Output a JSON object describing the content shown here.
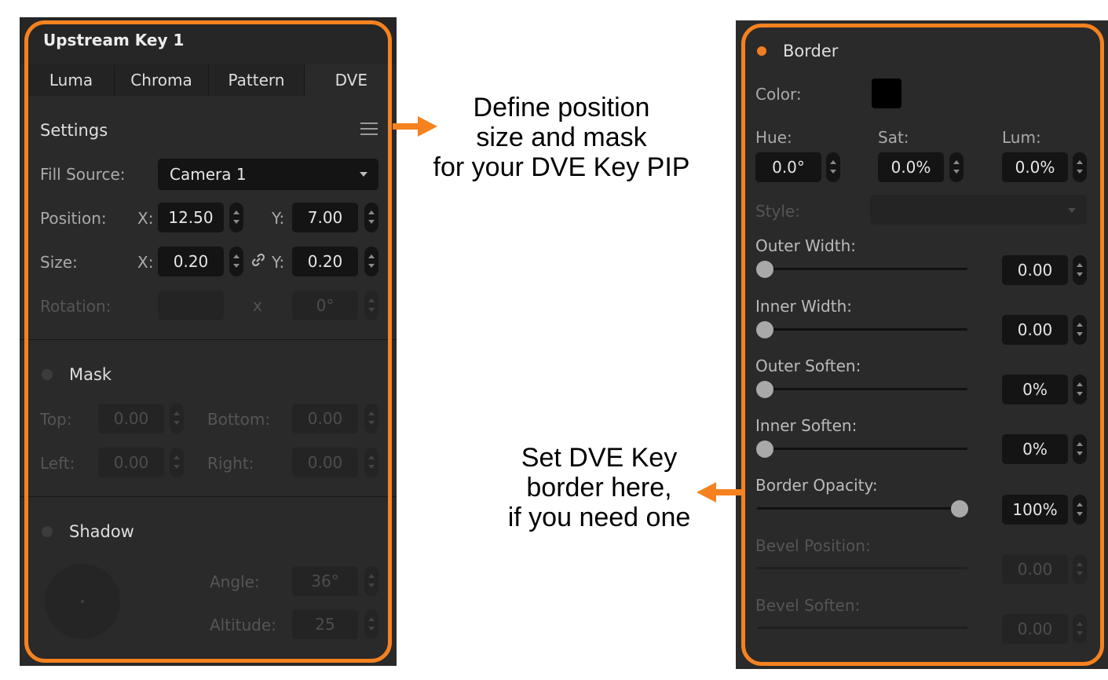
{
  "left_panel": {
    "title": "Upstream Key 1",
    "tabs": [
      {
        "label": "Luma",
        "active": false
      },
      {
        "label": "Chroma",
        "active": false
      },
      {
        "label": "Pattern",
        "active": false
      },
      {
        "label": "DVE",
        "active": true
      }
    ],
    "settings": {
      "heading": "Settings",
      "menu_icon": "hamburger-menu-icon",
      "fill_source_label": "Fill Source:",
      "fill_source_value": "Camera 1",
      "position_label": "Position:",
      "position_x_label": "X:",
      "position_x": "12.50",
      "position_y_label": "Y:",
      "position_y": "7.00",
      "size_label": "Size:",
      "size_x_label": "X:",
      "size_x": "0.20",
      "size_y_label": "Y:",
      "size_y": "0.20",
      "link_icon": "link-icon",
      "rotation_label": "Rotation:",
      "rotation_x": "x",
      "rotation_value": "0°"
    },
    "mask": {
      "heading": "Mask",
      "top_label": "Top:",
      "top_value": "0.00",
      "bottom_label": "Bottom:",
      "bottom_value": "0.00",
      "left_label": "Left:",
      "left_value": "0.00",
      "right_label": "Right:",
      "right_value": "0.00"
    },
    "shadow": {
      "heading": "Shadow",
      "angle_label": "Angle:",
      "angle_value": "36°",
      "altitude_label": "Altitude:",
      "altitude_value": "25"
    }
  },
  "right_panel": {
    "border_heading": "Border",
    "color_label": "Color:",
    "color_value": "#000000",
    "hue_label": "Hue:",
    "hue_value": "0.0°",
    "sat_label": "Sat:",
    "sat_value": "0.0%",
    "lum_label": "Lum:",
    "lum_value": "0.0%",
    "style_label": "Style:",
    "outer_width_label": "Outer Width:",
    "outer_width_value": "0.00",
    "inner_width_label": "Inner Width:",
    "inner_width_value": "0.00",
    "outer_soften_label": "Outer Soften:",
    "outer_soften_value": "0%",
    "inner_soften_label": "Inner Soften:",
    "inner_soften_value": "0%",
    "border_opacity_label": "Border Opacity:",
    "border_opacity_value": "100%",
    "bevel_position_label": "Bevel Position:",
    "bevel_position_value": "0.00",
    "bevel_soften_label": "Bevel Soften:",
    "bevel_soften_value": "0.00"
  },
  "annotations": {
    "top": [
      "Define position",
      "size and mask",
      "for your DVE Key PIP"
    ],
    "bottom": [
      "Set DVE Key",
      "border here,",
      "if you need one"
    ]
  },
  "colors": {
    "accent_orange": "#f5821f",
    "panel_bg": "#2a2a2a",
    "field_bg": "#141414"
  }
}
